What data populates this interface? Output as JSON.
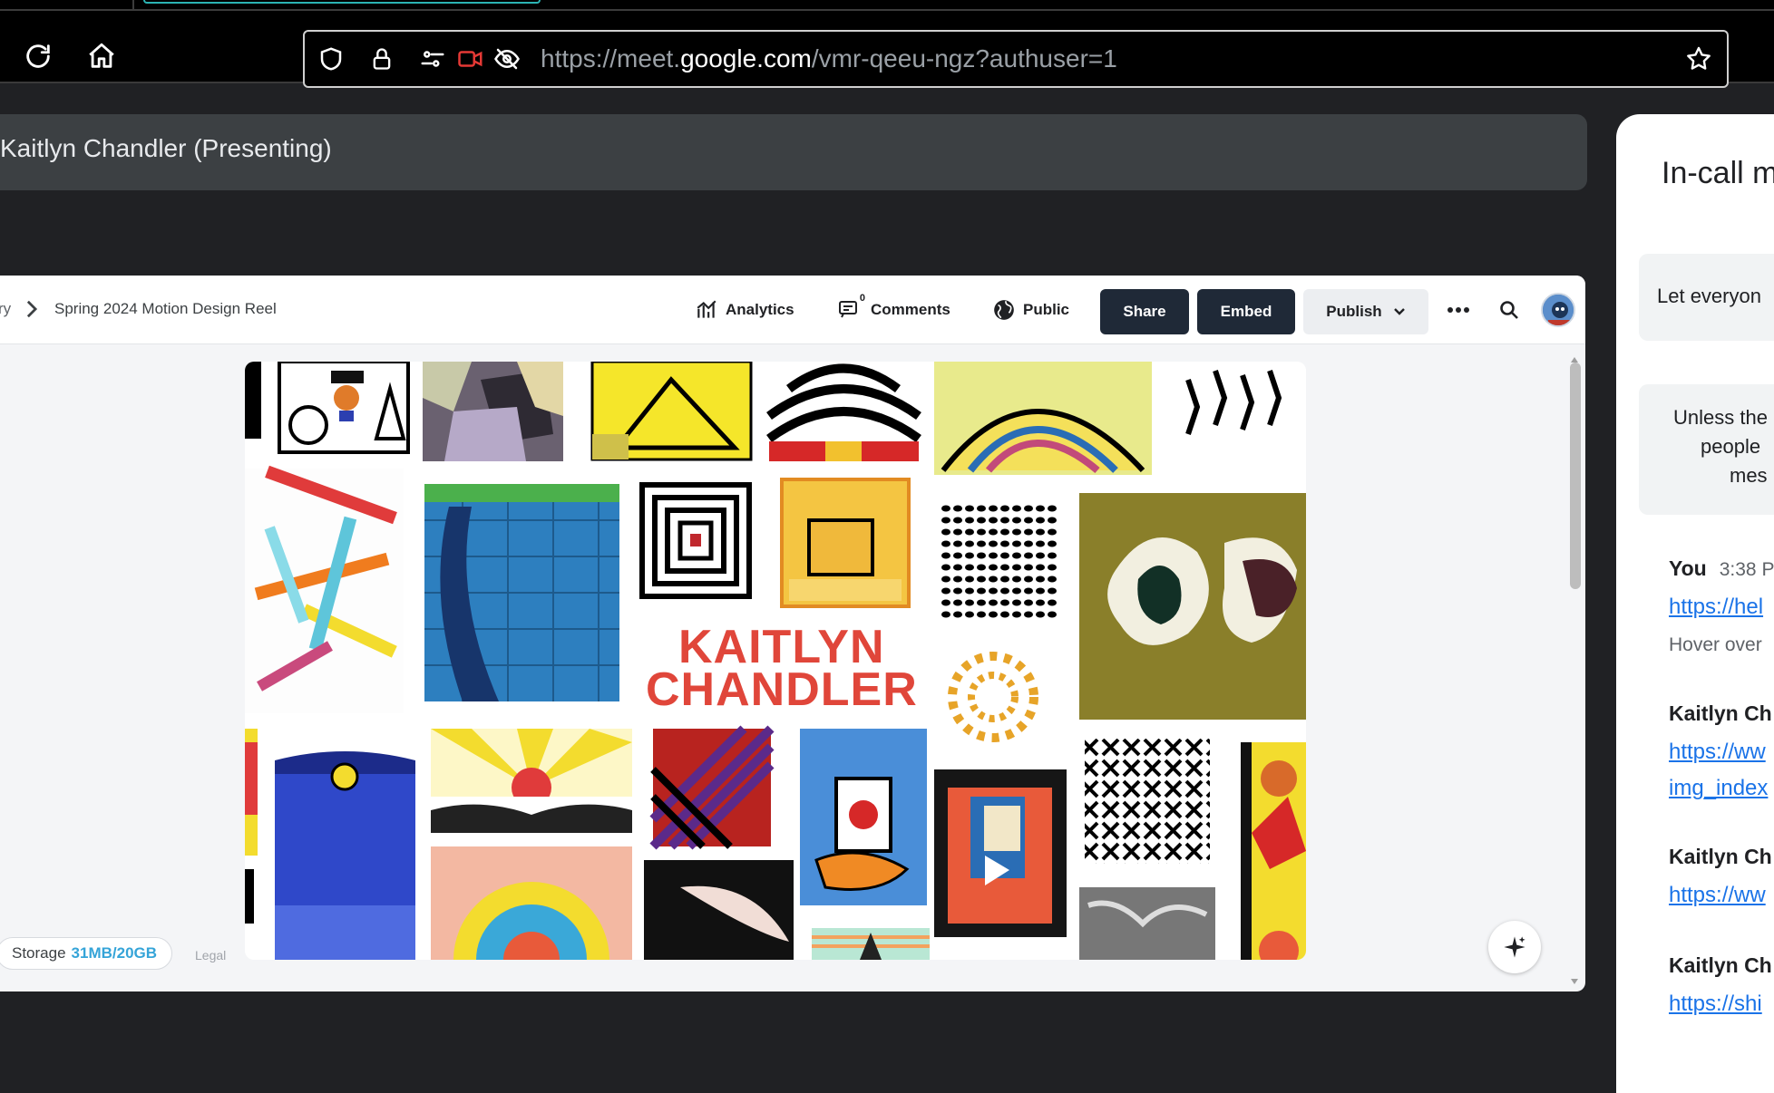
{
  "browser": {
    "url_prefix": "https://meet.",
    "url_domain": "google.com",
    "url_path": "/vmr-qeeu-ngz?authuser=1",
    "icons": [
      "reload-icon",
      "home-icon",
      "shield-icon",
      "lock-icon",
      "permissions-icon",
      "camera-blocked-icon",
      "tracking-off-icon",
      "bookmark-star-icon"
    ]
  },
  "meet": {
    "presenting_label": "Kaitlyn Chandler (Presenting)"
  },
  "shared_app": {
    "breadcrumb_prefix": "ry",
    "breadcrumb_current": "Spring 2024 Motion Design Reel",
    "analytics_label": "Analytics",
    "comments_label": "Comments",
    "comments_count": "0",
    "visibility_label": "Public",
    "share_label": "Share",
    "embed_label": "Embed",
    "publish_label": "Publish",
    "artwork_name_line1": "KAITLYN",
    "artwork_name_line2": "CHANDLER",
    "storage_label": "Storage",
    "storage_value": "31MB/20GB",
    "legal_label": "Legal"
  },
  "side_panel": {
    "title": "In-call m",
    "card1_text": "Let everyon",
    "card2_lines": [
      "Unless the",
      "people",
      "mes"
    ],
    "messages": [
      {
        "sender": "You",
        "time": "3:38 P",
        "links": [
          "https://hel"
        ],
        "text": "Hover over"
      },
      {
        "sender": "Kaitlyn Ch",
        "time": "",
        "links": [
          "https://ww",
          "img_index"
        ],
        "text": ""
      },
      {
        "sender": "Kaitlyn Ch",
        "time": "",
        "links": [
          "https://ww"
        ],
        "text": ""
      },
      {
        "sender": "Kaitlyn Ch",
        "time": "",
        "links": [
          "https://shi"
        ],
        "text": ""
      }
    ]
  },
  "colors": {
    "meet_bg": "#202124",
    "presenting_bar": "#3c4043",
    "primary_dark_button": "#1f2937",
    "link_blue": "#1a73e8",
    "storage_accent": "#35a4d8",
    "artwork_name": "#e0463a"
  }
}
